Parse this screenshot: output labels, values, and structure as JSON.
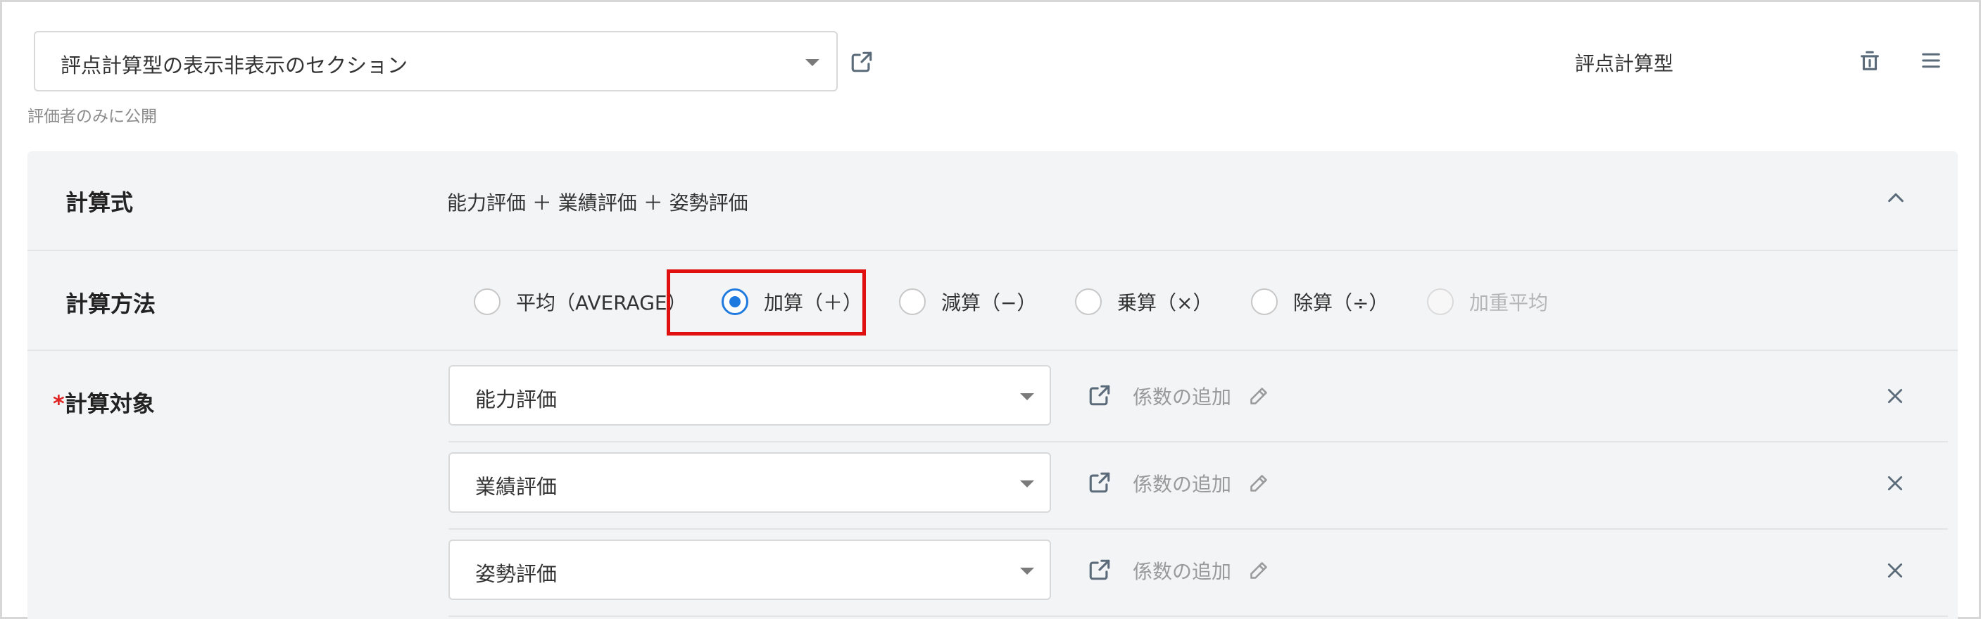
{
  "header": {
    "section_select_value": "評点計算型の表示非表示のセクション",
    "visibility_note": "評価者のみに公開",
    "section_type": "評点計算型"
  },
  "icons": {
    "external_link": "external-link-icon",
    "dropdown": "chevron-down-icon",
    "trash": "trash-icon",
    "menu": "hamburger-menu-icon",
    "collapse": "chevron-up-icon",
    "pencil": "pencil-icon",
    "remove": "close-icon"
  },
  "colors": {
    "accent": "#1f7ae0",
    "highlight": "#e01010",
    "required": "#e02424",
    "panel_bg": "#f3f4f6"
  },
  "formula": {
    "label": "計算式",
    "value": "能力評価 ＋ 業績評価 ＋ 姿勢評価"
  },
  "method": {
    "label": "計算方法",
    "options": [
      {
        "label": "平均（AVERAGE）",
        "checked": false,
        "disabled": false
      },
      {
        "label": "加算（＋）",
        "checked": true,
        "disabled": false
      },
      {
        "label": "減算（−）",
        "checked": false,
        "disabled": false
      },
      {
        "label": "乗算（×）",
        "checked": false,
        "disabled": false
      },
      {
        "label": "除算（÷）",
        "checked": false,
        "disabled": false
      },
      {
        "label": "加重平均",
        "checked": false,
        "disabled": true
      }
    ]
  },
  "targets": {
    "required_mark": "*",
    "label": "計算対象",
    "coefficient_label": "係数の追加",
    "items": [
      {
        "value": "能力評価"
      },
      {
        "value": "業績評価"
      },
      {
        "value": "姿勢評価"
      }
    ]
  }
}
